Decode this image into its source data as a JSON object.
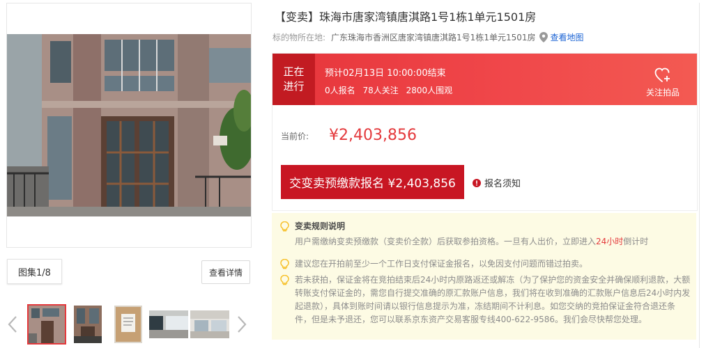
{
  "listing": {
    "title": "【变卖】珠海市唐家湾镇唐淇路1号1栋1单元1501房",
    "address_label": "标的物所在地:",
    "address_value": "广东珠海市香洲区唐家湾镇唐淇路1号1栋1单元1501房",
    "map_link": "查看地图"
  },
  "gallery": {
    "counter": "图集1/8",
    "view_detail": "查看详情",
    "thumb_count": 5,
    "active_index": 0
  },
  "auction": {
    "status": "正在进行",
    "end_time": "预计02月13日 10:00:00结束",
    "signups": "0人报名",
    "followers": "78人关注",
    "watchers": "2800人围观",
    "follow_label": "关注拍品",
    "price_label": "当前价:",
    "price": "¥2,403,856",
    "signup_button": "交变卖预缴款报名 ¥2,403,856",
    "notice": "报名须知"
  },
  "rules": {
    "title": "变卖规则说明",
    "rule1_pre": "用户需缴纳变卖预缴款（变卖价全款）后获取参拍资格。一旦有人出价，立即进入",
    "rule1_highlight": "24小时",
    "rule1_post": "倒计时",
    "rule2": "建议您在开拍前至少一个工作日支付保证金报名，以免因支付问题而错过拍卖。",
    "rule3": "若未获拍，保证金将在竞拍结束后24小时内原路返还或解冻（为了保护您的资金安全并确保顺利退款，大额转账支付保证金的，需您自行提交准确的原汇款账户信息，我们将在收到准确的汇款账户信息后24小时内发起退款），具体到账时间请以银行信息提示为准，冻结期间不计利息。如您交纳的竞拍保证金符合退还条件，但是未予退还，您可以联系京东资产交易客服专线400-622-9586。我们会尽快帮您处理。"
  },
  "colors": {
    "accent_red": "#e4393c",
    "button_red": "#c81623",
    "status_bar": "#ec3f42",
    "link_blue": "#1c64d4",
    "notice_bg": "#fdfbe4",
    "bulb_yellow": "#f7c12d"
  },
  "icons": [
    "location-pin-icon",
    "heart-plus-icon",
    "info-circle-icon",
    "lightbulb-icon",
    "chevron-left-icon",
    "chevron-right-icon"
  ]
}
